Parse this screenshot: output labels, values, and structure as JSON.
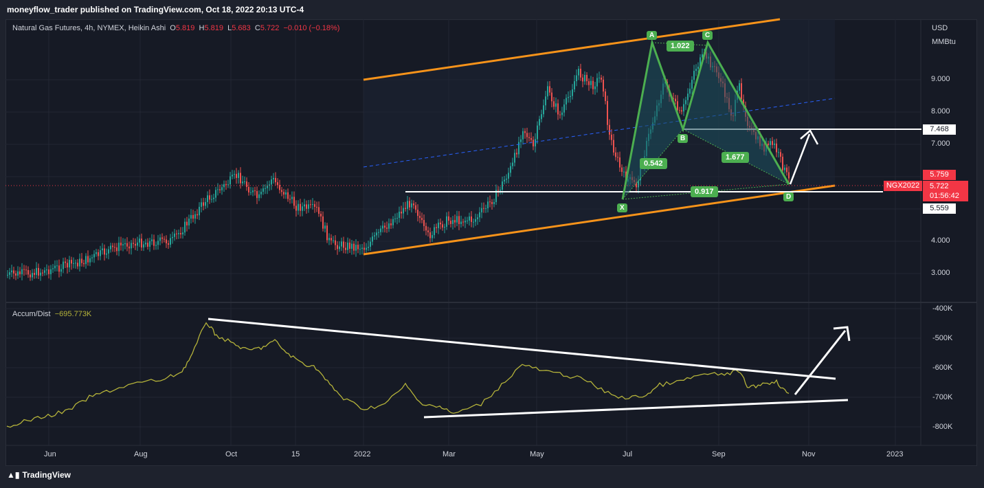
{
  "header": {
    "published": "moneyflow_trader published on TradingView.com, Oct 18, 2022 20:13 UTC-4"
  },
  "legend": {
    "symbol": "Natural Gas Futures, 4h, NYMEX, Heikin Ashi",
    "o_label": "O",
    "o_value": "5.819",
    "h_label": "H",
    "h_value": "5.819",
    "l_label": "L",
    "l_value": "5.683",
    "c_label": "C",
    "c_value": "5.722",
    "change": "−0.010 (−0.18%)"
  },
  "indicator": {
    "name": "Accum/Dist",
    "value": "−695.773K"
  },
  "price_axis": {
    "currency": "USD",
    "unit": "MMBtu",
    "ticks": [
      "9.000",
      "8.000",
      "7.000",
      "4.000",
      "3.000"
    ],
    "line_level": "7.468",
    "low_level": "5.559",
    "tag_high": "5.759",
    "tag_last": "5.722",
    "countdown": "01:56:42",
    "symbol_tag": "NGX2022"
  },
  "ad_axis": {
    "ticks": [
      "-400K",
      "-500K",
      "-600K",
      "-700K",
      "-800K"
    ]
  },
  "time_axis": {
    "labels": [
      "Jun",
      "Aug",
      "Oct",
      "15",
      "2022",
      "Mar",
      "May",
      "Jul",
      "Sep",
      "Nov",
      "2023"
    ]
  },
  "pattern": {
    "points": [
      "X",
      "A",
      "B",
      "C",
      "D"
    ],
    "ratios": [
      "1.022",
      "0.542",
      "1.677",
      "0.917"
    ]
  },
  "footer": {
    "brand": "TradingView"
  },
  "colors": {
    "up": "#26a69a",
    "down": "#ef5350",
    "channel": "#f7931a",
    "pattern": "#4caf50",
    "ad_line": "#b5b33a",
    "midline": "#2962ff"
  }
}
